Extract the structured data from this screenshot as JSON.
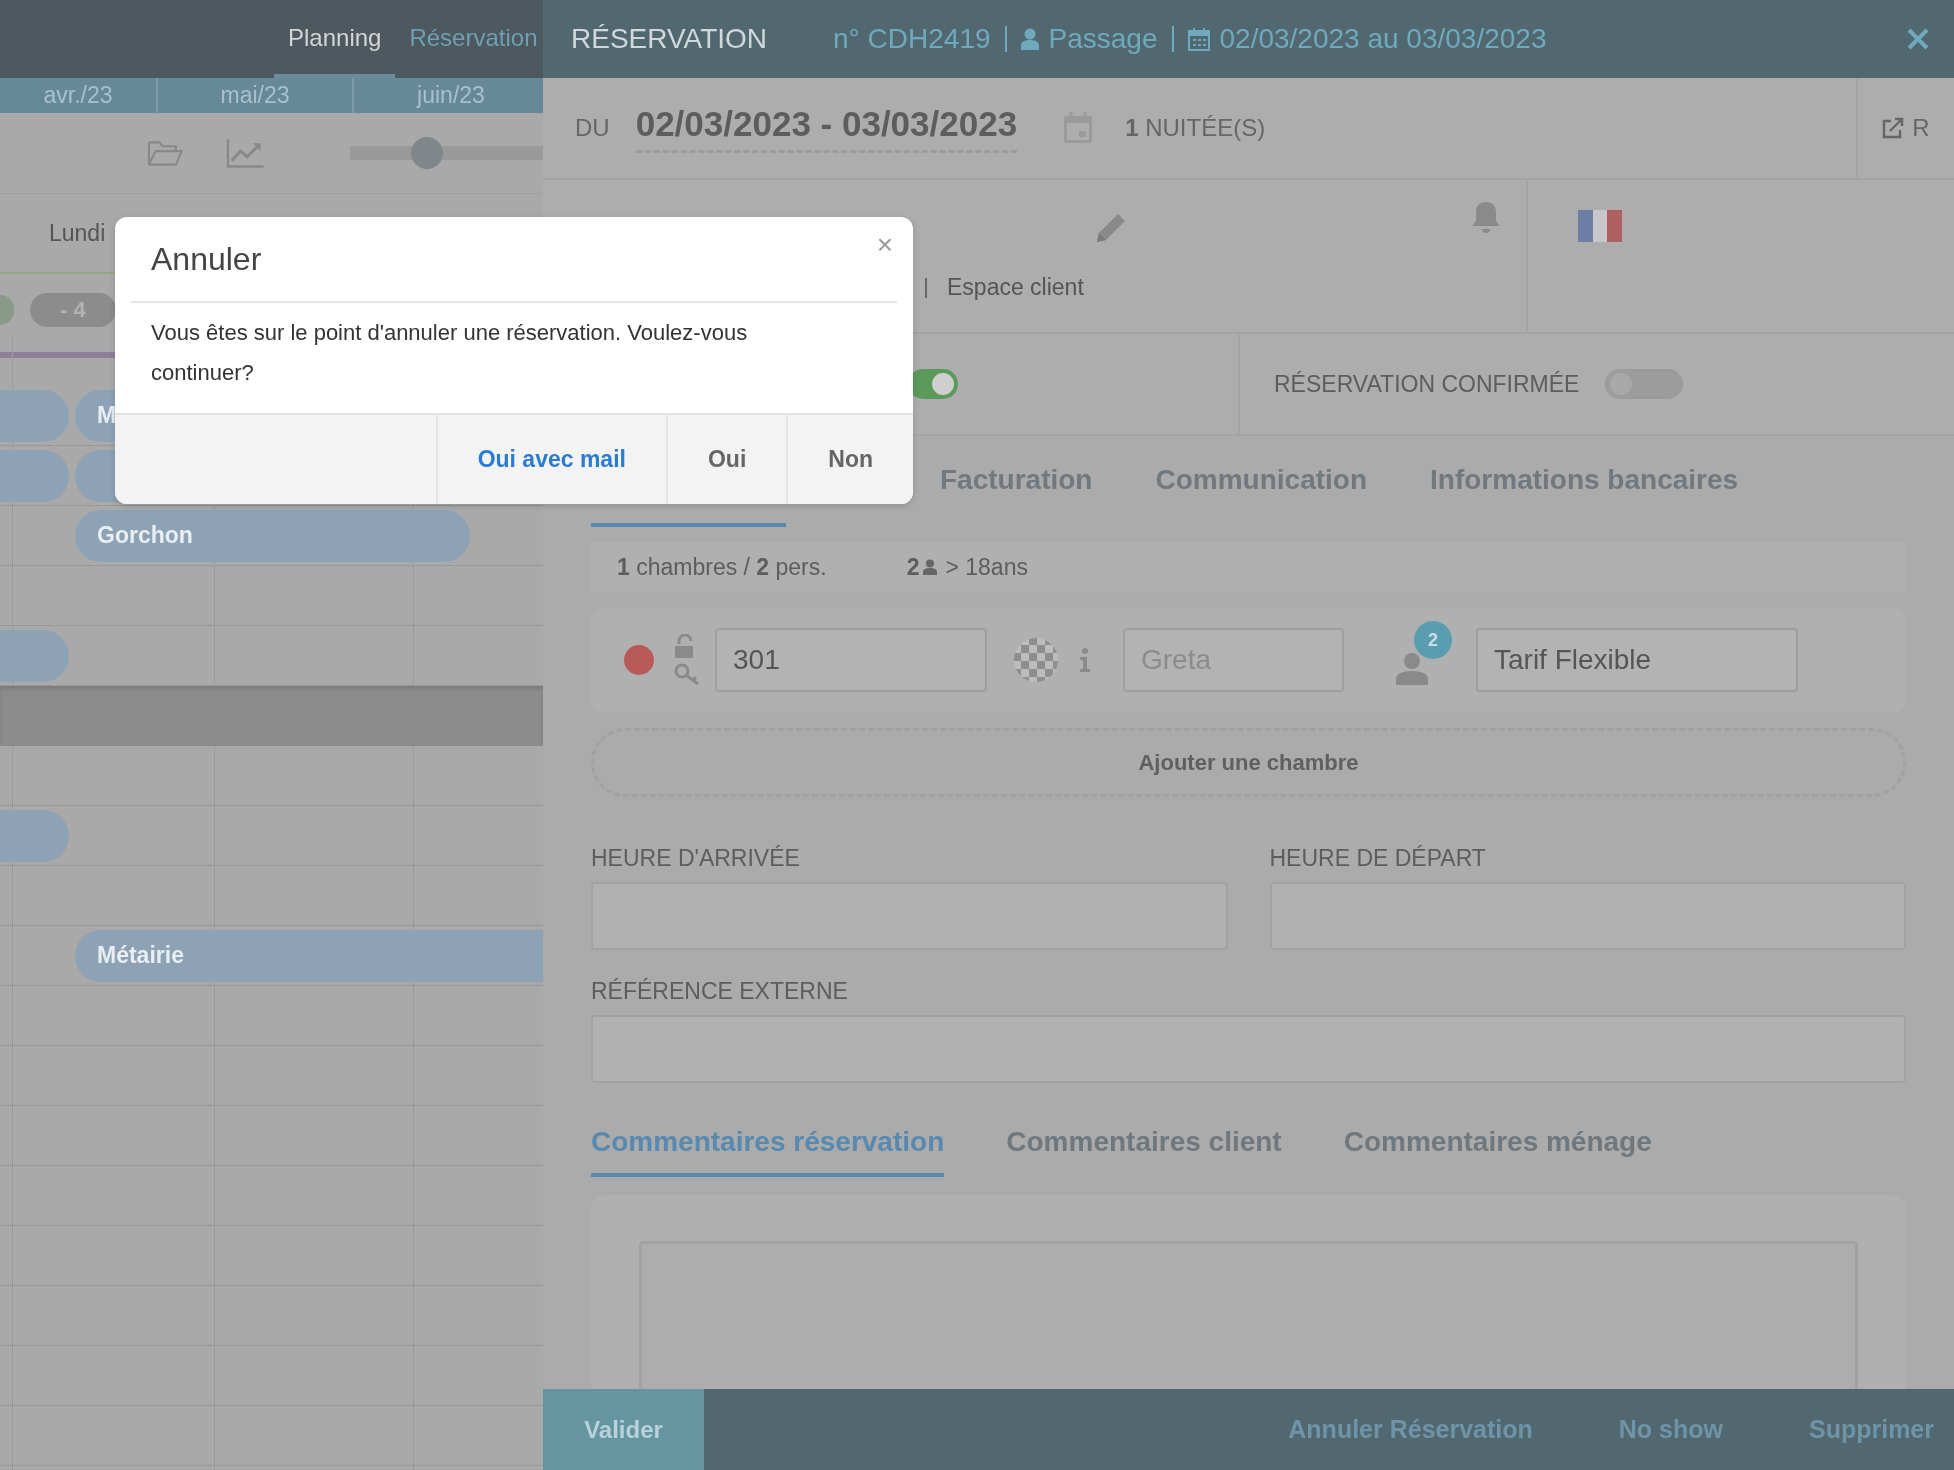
{
  "planning": {
    "tabs": [
      {
        "label": "Planning",
        "selected": true
      },
      {
        "label": "Réservation",
        "selected": false
      }
    ],
    "months": [
      "avr./23",
      "mai/23",
      "juin/23"
    ],
    "zoom": {
      "level": 0.4
    },
    "day_header": "Lundi",
    "count_badge": "- 4",
    "rows": [
      {
        "shaded": false,
        "bookings": [
          {
            "kind": "stub"
          },
          {
            "kind": "bar",
            "label": "M"
          }
        ]
      },
      {
        "shaded": false,
        "bookings": [
          {
            "kind": "stub"
          },
          {
            "kind": "bar"
          }
        ]
      },
      {
        "shaded": false,
        "bookings": [
          {
            "kind": "bar",
            "label": "Gorchon"
          }
        ]
      },
      {
        "shaded": false,
        "bookings": []
      },
      {
        "shaded": false,
        "bookings": [
          {
            "kind": "stub"
          }
        ]
      },
      {
        "shaded": true,
        "bookings": []
      },
      {
        "shaded": false,
        "bookings": []
      },
      {
        "shaded": false,
        "bookings": [
          {
            "kind": "stub"
          }
        ]
      },
      {
        "shaded": false,
        "bookings": []
      },
      {
        "shaded": false,
        "bookings": [
          {
            "kind": "wide",
            "label": "Métairie"
          }
        ]
      },
      {
        "shaded": false,
        "bookings": []
      },
      {
        "shaded": false,
        "bookings": []
      },
      {
        "shaded": false,
        "bookings": []
      },
      {
        "shaded": false,
        "bookings": []
      },
      {
        "shaded": false,
        "bookings": []
      },
      {
        "shaded": false,
        "bookings": []
      },
      {
        "shaded": false,
        "bookings": []
      },
      {
        "shaded": false,
        "bookings": []
      }
    ]
  },
  "reservation": {
    "title": "RÉSERVATION",
    "number": "n° CDH2419",
    "type": "Passage",
    "period": "02/03/2023 au 03/03/2023",
    "dates": {
      "label": "DU",
      "range": "02/03/2023 - 03/03/2023",
      "nights": "**1** NUITÉE(S)"
    },
    "open_link": "R",
    "client_link": "Espace client",
    "toggles": [
      {
        "on": true
      },
      {
        "label": "RÉSERVATION CONFIRMÉE",
        "on": false
      }
    ],
    "tabs": [
      {
        "selected": true
      },
      {
        "label": "Facturation",
        "selected": false
      },
      {
        "label": "Communication",
        "selected": false
      },
      {
        "label": "Informations bancaires",
        "selected": false
      }
    ],
    "summary": {
      "rooms": "**1** chambres / **2** pers.",
      "adults": "2",
      "age": "> 18ans"
    },
    "rooms": [
      {
        "color": "#b85a5a",
        "number": "301",
        "placeholder": "Greta",
        "occupants": "2",
        "rate": "Tarif Flexible"
      }
    ],
    "add_room": "Ajouter une chambre",
    "fields": [
      {
        "label": "HEURE D'ARRIVÉE"
      },
      {
        "label": "HEURE DE DÉPART"
      },
      {
        "label": "RÉFÉRENCE EXTERNE"
      }
    ],
    "comment_tabs": [
      {
        "label": "Commentaires réservation",
        "selected": true
      },
      {
        "label": "Commentaires client",
        "selected": false
      },
      {
        "label": "Commentaires ménage",
        "selected": false
      }
    ],
    "validate": "Valider",
    "actions": [
      "Annuler Réservation",
      "No show",
      "Supprimer"
    ]
  },
  "dialog": {
    "title": "Annuler",
    "close": "×",
    "message": "Vous êtes sur le point d'annuler une réservation. Voulez-vous continuer?",
    "buttons": [
      {
        "label": "Oui avec mail",
        "kind": "primary"
      },
      {
        "label": "Oui",
        "kind": "default"
      },
      {
        "label": "Non",
        "kind": "default"
      }
    ]
  }
}
